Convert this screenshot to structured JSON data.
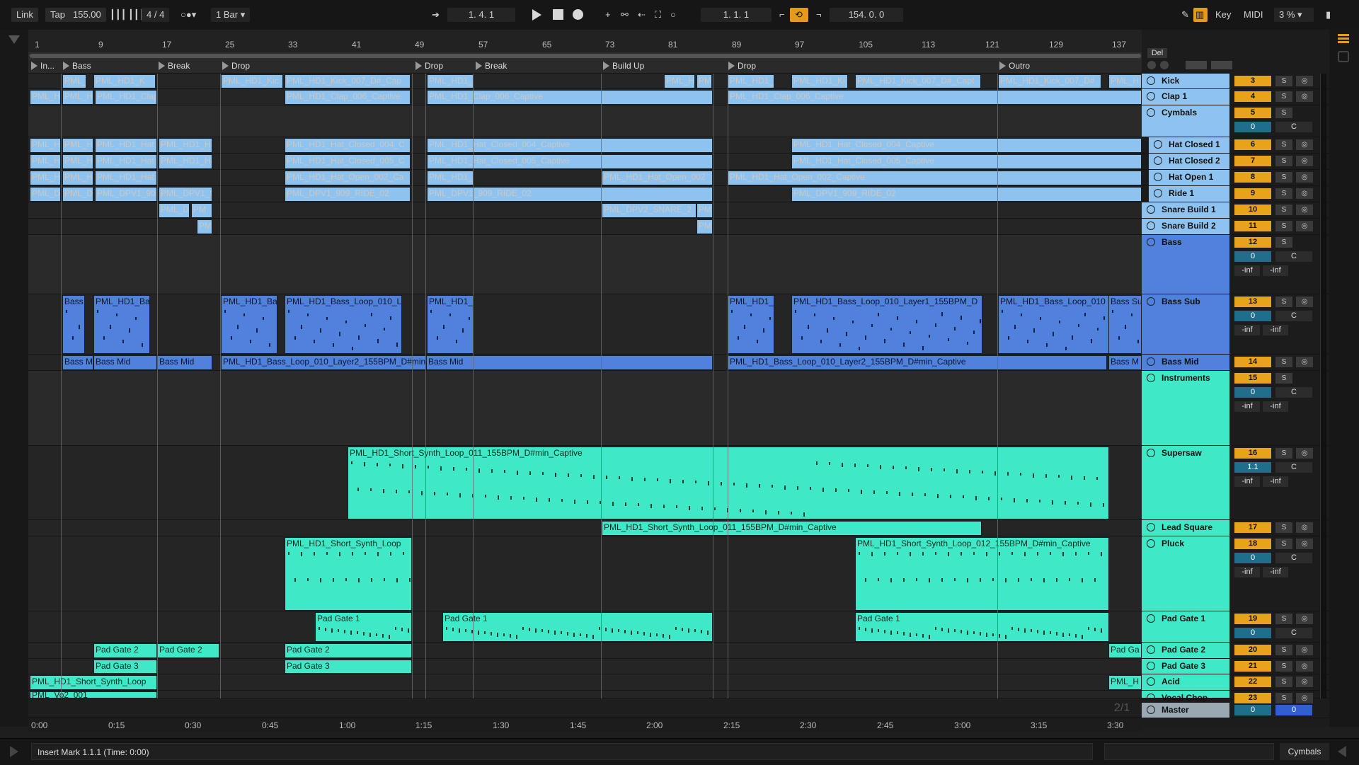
{
  "transport": {
    "link": "Link",
    "tap": "Tap",
    "tempo": "155.00",
    "signature": "4 / 4",
    "quantize": "1 Bar",
    "position": "1.   4.   1",
    "loop_start": "1.   1.   1",
    "loop_length": "154.   0.   0",
    "key": "Key",
    "midi": "MIDI",
    "cpu": "3 %"
  },
  "ruler": {
    "bars": [
      "1",
      "9",
      "17",
      "25",
      "33",
      "41",
      "49",
      "57",
      "65",
      "73",
      "81",
      "89",
      "97",
      "105",
      "113",
      "121",
      "129",
      "137"
    ]
  },
  "locators": [
    "In...",
    "Bass",
    "Break",
    "Drop",
    "Drop",
    "Break",
    "Build Up",
    "Drop",
    "Outro"
  ],
  "time_ruler": [
    "0:00",
    "0:15",
    "0:30",
    "0:45",
    "1:00",
    "1:15",
    "1:30",
    "1:45",
    "2:00",
    "2:15",
    "2:30",
    "2:45",
    "3:00",
    "3:15",
    "3:30"
  ],
  "page_indicator": "2/1",
  "clip_labels": {
    "kick": [
      "PML_",
      "PML_HD1_K",
      "PML_HD1_Kic",
      "PML_HD1_Kick_007_D#_Cap",
      "PML_HD1_",
      "PML_H",
      "PM",
      "PML_HD1_",
      "PML_HD1_Ki",
      "PML_HD1_Kick_007_D#_Capt",
      "PML_HD1_Kick_007_D#",
      "PML_H"
    ],
    "clap": [
      "PML_H",
      "PML_H",
      "PML_HD1_Clap",
      "PML_HD1_Clap_006_Captive",
      "PML_HD1_Clap_006_Captive",
      "PML_HD1_Clap_006_Captive"
    ],
    "hat_closed_1": [
      "PML_H",
      "PML_H",
      "PML_HD1_Hat",
      "PML_HD1_Ha",
      "PML_HD1_Hat_Closed_004_C",
      "PML_HD1_Hat_Closed_004_Captive",
      "PML_HD1_Hat_Closed_004_Captive"
    ],
    "hat_closed_2": [
      "PML_H",
      "PML_H",
      "PML_HD1_Hat",
      "PML_HD1_Ha",
      "PML_HD1_Hat_Closed_005_C",
      "PML_HD1_Hat_Closed_005_Captive",
      "PML_HD1_Hat_Closed_005_Captive"
    ],
    "hat_open": [
      "PML_H",
      "PML_H",
      "PML_HD1_Hat",
      "PML_HD1_Hat_Open_002_Ca",
      "PML_HD1_",
      "PML_HD1_Hat_Open_002",
      "PML_HD1_Hat_Open_002_Captive"
    ],
    "ride": [
      "PML_D",
      "PML_D",
      "PML_DPV1_909",
      "PML_DPV1_9",
      "PML_DPV1_909_RIDE_02",
      "PML_DPV1_909_RIDE_02",
      "PML_DPV1_909_RIDE_02"
    ],
    "snare1": [
      "PML_DP",
      "PM",
      "PML_DPV2_SNARE_2",
      "PM"
    ],
    "snare2": [
      "PM",
      "PM"
    ],
    "bass_sub": [
      "Bass",
      "PML_HD1_Ba",
      "PML_HD1_Ba",
      "PML_HD1_Bass_Loop_010_L",
      "PML_HD1_",
      "PML_HD1_",
      "PML_HD1_Bass_Loop_010_Layer1_155BPM_D",
      "PML_HD1_Bass_Loop_010",
      "Bass Su"
    ],
    "bass_mid": [
      "Bass Mi",
      "Bass Mid",
      "Bass Mid",
      "PML_HD1_Bass_Loop_010_Layer2_155BPM_D#min_Captive",
      "Bass Mid",
      "PML_HD1_Bass_Loop_010_Layer2_155BPM_D#min_Captive",
      "Bass M"
    ],
    "supersaw": [
      "PML_HD1_Short_Synth_Loop_011_155BPM_D#min_Captive"
    ],
    "lead_square": [
      "PML_HD1_Short_Synth_Loop_011_155BPM_D#min_Captive"
    ],
    "pluck": [
      "PML_HD1_Short_Synth_Loop",
      "PML_HD1_Short_Synth_Loop_012_155BPM_D#min_Captive"
    ],
    "pad_gate_1": [
      "Pad Gate 1",
      "Pad Gate 1",
      "Pad Gate 1"
    ],
    "pad_gate_2": [
      "Pad Gate 2",
      "Pad Gate 2",
      "Pad Gate 2",
      "Pad Ga"
    ],
    "pad_gate_3": [
      "Pad Gate 3",
      "Pad Gate 3"
    ],
    "acid": [
      "PML_HD1_Short_Synth_Loop",
      "PML_H"
    ],
    "vocal_chop": [
      "PML_Vo2_001"
    ]
  },
  "mixer": {
    "header_button": "Del",
    "tracks": [
      {
        "name": "Kick",
        "num": "3",
        "solo": "S"
      },
      {
        "name": "Clap 1",
        "num": "4",
        "solo": "S"
      },
      {
        "name": "Cymbals",
        "num": "5",
        "solo": "S",
        "vol": "0",
        "pan": "C"
      },
      {
        "name": "Hat Closed 1",
        "num": "6",
        "solo": "S"
      },
      {
        "name": "Hat Closed 2",
        "num": "7",
        "solo": "S"
      },
      {
        "name": "Hat Open 1",
        "num": "8",
        "solo": "S"
      },
      {
        "name": "Ride 1",
        "num": "9",
        "solo": "S"
      },
      {
        "name": "Snare Build 1",
        "num": "10",
        "solo": "S"
      },
      {
        "name": "Snare Build 2",
        "num": "11",
        "solo": "S"
      },
      {
        "name": "Bass",
        "num": "12",
        "solo": "S",
        "vol": "0",
        "pan": "C",
        "inf1": "-inf",
        "inf2": "-inf"
      },
      {
        "name": "Bass Sub",
        "num": "13",
        "solo": "S",
        "vol": "0",
        "pan": "C",
        "inf1": "-inf",
        "inf2": "-inf"
      },
      {
        "name": "Bass Mid",
        "num": "14",
        "solo": "S"
      },
      {
        "name": "Instruments",
        "num": "15",
        "solo": "S",
        "vol": "0",
        "pan": "C",
        "inf1": "-inf",
        "inf2": "-inf"
      },
      {
        "name": "Supersaw",
        "num": "16",
        "solo": "S",
        "vol": "1.1",
        "pan": "C",
        "inf1": "-inf",
        "inf2": "-inf"
      },
      {
        "name": "Lead Square",
        "num": "17",
        "solo": "S"
      },
      {
        "name": "Pluck",
        "num": "18",
        "solo": "S",
        "vol": "0",
        "pan": "C",
        "inf1": "-inf",
        "inf2": "-inf"
      },
      {
        "name": "Pad Gate 1",
        "num": "19",
        "solo": "S",
        "vol": "0",
        "pan": "C"
      },
      {
        "name": "Pad Gate 2",
        "num": "20",
        "solo": "S"
      },
      {
        "name": "Pad Gate 3",
        "num": "21",
        "solo": "S"
      },
      {
        "name": "Acid",
        "num": "22",
        "solo": "S"
      },
      {
        "name": "Vocal Chop",
        "num": "23",
        "solo": "S"
      }
    ],
    "master": {
      "name": "Master",
      "vol": "0",
      "pan": "0"
    }
  },
  "status": {
    "message": "Insert Mark 1.1.1 (Time: 0:00)",
    "selected_track": "Cymbals"
  },
  "colors": {
    "drums": "#8fc3ef",
    "bass": "#4f81dd",
    "synth": "#3fe8c6",
    "accent": "#e59a19"
  }
}
